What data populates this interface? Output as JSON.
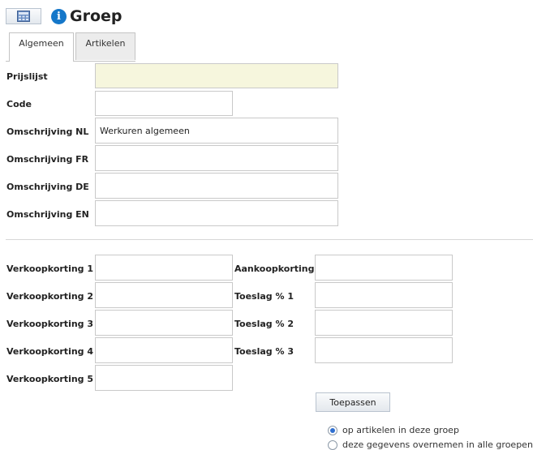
{
  "header": {
    "title": "Groep",
    "icon_button": "calculator-icon",
    "info_icon": "i"
  },
  "tabs": [
    {
      "label": "Algemeen",
      "active": true
    },
    {
      "label": "Artikelen",
      "active": false
    }
  ],
  "fields": {
    "prijslijst": {
      "label": "Prijslijst",
      "value": ""
    },
    "code": {
      "label": "Code",
      "value": ""
    },
    "omschrijving_nl": {
      "label": "Omschrijving NL",
      "value": "Werkuren algemeen"
    },
    "omschrijving_fr": {
      "label": "Omschrijving FR",
      "value": ""
    },
    "omschrijving_de": {
      "label": "Omschrijving DE",
      "value": ""
    },
    "omschrijving_en": {
      "label": "Omschrijving EN",
      "value": ""
    }
  },
  "kortingen": {
    "verkoopkorting_1": {
      "label": "Verkoopkorting 1",
      "value": ""
    },
    "verkoopkorting_2": {
      "label": "Verkoopkorting 2",
      "value": ""
    },
    "verkoopkorting_3": {
      "label": "Verkoopkorting 3",
      "value": ""
    },
    "verkoopkorting_4": {
      "label": "Verkoopkorting 4",
      "value": ""
    },
    "verkoopkorting_5": {
      "label": "Verkoopkorting 5",
      "value": ""
    },
    "aankoopkorting": {
      "label": "Aankoopkorting",
      "value": ""
    },
    "toeslag_1": {
      "label": "Toeslag % 1",
      "value": ""
    },
    "toeslag_2": {
      "label": "Toeslag % 2",
      "value": ""
    },
    "toeslag_3": {
      "label": "Toeslag % 3",
      "value": ""
    }
  },
  "actions": {
    "apply_label": "Toepassen",
    "options": [
      {
        "label": "op artikelen in deze groep",
        "selected": true
      },
      {
        "label": "deze gegevens overnemen in alle groepen",
        "selected": false
      }
    ]
  },
  "colors": {
    "accent": "#1577c9",
    "readonly_field": "#f6f6dd",
    "radio_selected": "#2f6fd0"
  }
}
